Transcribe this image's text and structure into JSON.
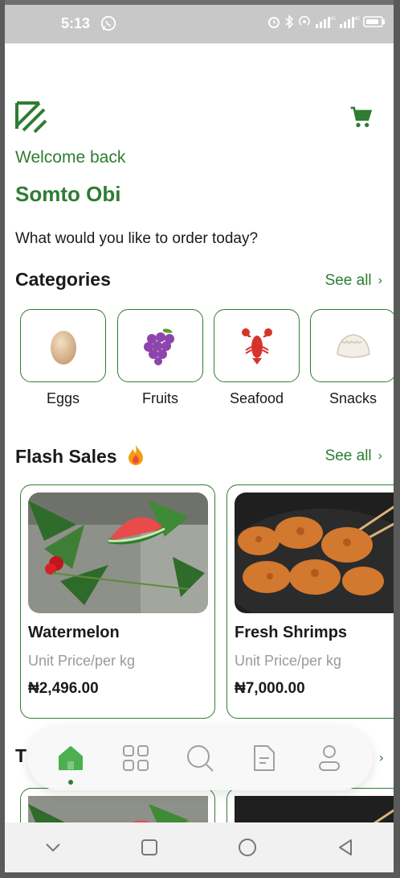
{
  "status_bar": {
    "time": "5:13"
  },
  "header": {
    "welcome": "Welcome back",
    "username": "Somto Obi",
    "question": "What would you like to order today?"
  },
  "categories": {
    "title": "Categories",
    "see_all": "See all",
    "items": [
      {
        "label": "Eggs",
        "icon": "egg-icon"
      },
      {
        "label": "Fruits",
        "icon": "grapes-icon"
      },
      {
        "label": "Seafood",
        "icon": "lobster-icon"
      },
      {
        "label": "Snacks",
        "icon": "dumpling-icon"
      }
    ]
  },
  "flash_sales": {
    "title": "Flash Sales",
    "see_all": "See all",
    "products": [
      {
        "name": "Watermelon",
        "unit": "Unit Price/per kg",
        "price": "₦2,496.00"
      },
      {
        "name": "Fresh Shrimps",
        "unit": "Unit Price/per kg",
        "price": "₦7,000.00"
      }
    ]
  },
  "next_section": {
    "title_partial": "T"
  },
  "bottom_nav": {
    "items": [
      "home-icon",
      "grid-icon",
      "search-icon",
      "orders-icon",
      "profile-icon"
    ],
    "active": "home-icon"
  },
  "colors": {
    "accent": "#2e7d32",
    "muted": "#9a9a9a"
  }
}
